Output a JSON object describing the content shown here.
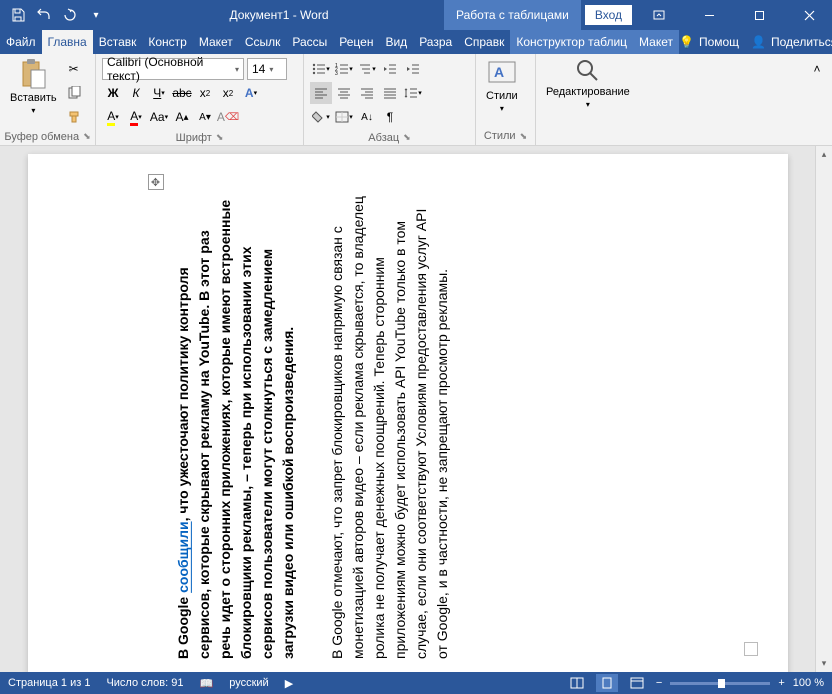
{
  "title": "Документ1 - Word",
  "table_tools": "Работа с таблицами",
  "signin": "Вход",
  "tabs": {
    "file": "Файл",
    "home": "Главна",
    "insert": "Вставк",
    "design": "Констр",
    "layout": "Макет",
    "references": "Ссылк",
    "mailings": "Рассы",
    "review": "Рецен",
    "view": "Вид",
    "developer": "Разра",
    "help": "Справк",
    "tbl_design": "Конструктор таблиц",
    "tbl_layout": "Макет"
  },
  "help_link": "Помощ",
  "share_link": "Поделиться",
  "ribbon": {
    "clipboard": {
      "label": "Буфер обмена",
      "paste": "Вставить"
    },
    "font": {
      "label": "Шрифт",
      "name": "Calibri (Основной текст)",
      "size": "14"
    },
    "paragraph": {
      "label": "Абзац"
    },
    "styles": {
      "label": "Стили",
      "btn": "Стили"
    },
    "editing": {
      "label": "",
      "btn": "Редактирование"
    }
  },
  "document": {
    "para1_pre": "В Google ",
    "para1_link": "сообщили",
    "para1_post": ", что ужесточают политику контроля сервисов, которые скрывают рекламу на YouTube. В этот раз речь идет о сторонних приложениях, которые имеют встроенные блокировщики рекламы, – теперь при использовании этих сервисов пользователи могут столкнуться с замедлением загрузки видео или ошибкой воспроизведения.",
    "para2": "В Google отмечают, что запрет блокировщиков напрямую связан с монетизацией авторов видео – если реклама скрывается, то владелец ролика не получает денежных поощрений. Теперь сторонним приложениям можно будет использовать API YouTube только в том случае, если они соответствуют Условиям предоставления услуг API от Google, и в частности, не запрещают просмотр рекламы."
  },
  "status": {
    "page": "Страница 1 из 1",
    "words": "Число слов: 91",
    "lang": "русский",
    "zoom": "100 %"
  }
}
